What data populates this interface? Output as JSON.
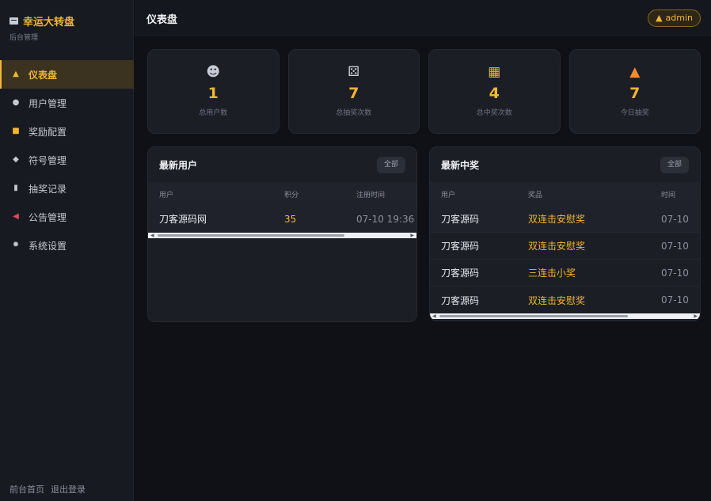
{
  "app": {
    "title": "幸运大转盘",
    "subtitle": "后台管理"
  },
  "sidebar": {
    "items": [
      {
        "label": "仪表盘",
        "icon": "home-icon",
        "active": true
      },
      {
        "label": "用户管理",
        "icon": "users-icon"
      },
      {
        "label": "奖励配置",
        "icon": "gift-icon"
      },
      {
        "label": "符号管理",
        "icon": "dice-icon"
      },
      {
        "label": "抽奖记录",
        "icon": "clipboard-icon"
      },
      {
        "label": "公告管理",
        "icon": "megaphone-icon"
      },
      {
        "label": "系统设置",
        "icon": "gear-icon"
      }
    ],
    "footer": {
      "home": "前台首页",
      "logout": "退出登录"
    }
  },
  "header": {
    "title": "仪表盘",
    "user": "admin"
  },
  "stats": [
    {
      "icon": "users-icon",
      "value": "1",
      "label": "总用户数"
    },
    {
      "icon": "dice-icon",
      "value": "7",
      "label": "总抽奖次数"
    },
    {
      "icon": "gift-icon",
      "value": "4",
      "label": "总中奖次数"
    },
    {
      "icon": "fire-icon",
      "value": "7",
      "label": "今日抽奖"
    }
  ],
  "recent_users": {
    "title": "最新用户",
    "all_label": "全部",
    "columns": [
      "用户",
      "积分",
      "注册时间"
    ],
    "rows": [
      {
        "user": "刀客源码网",
        "points": "35",
        "time": "07-10 19:36"
      }
    ]
  },
  "recent_wins": {
    "title": "最新中奖",
    "all_label": "全部",
    "columns": [
      "用户",
      "奖品",
      "时间"
    ],
    "rows": [
      {
        "user": "刀客源码",
        "prize": "双连击安慰奖",
        "time": "07-10"
      },
      {
        "user": "刀客源码",
        "prize": "双连击安慰奖",
        "time": "07-10"
      },
      {
        "user": "刀客源码",
        "prize": "三连击小奖",
        "time": "07-10"
      },
      {
        "user": "刀客源码",
        "prize": "双连击安慰奖",
        "time": "07-10"
      }
    ]
  },
  "colors": {
    "accent": "#f2b731",
    "background": "#0f1117",
    "sidebar": "#171a21",
    "card": "#1b1e25"
  }
}
